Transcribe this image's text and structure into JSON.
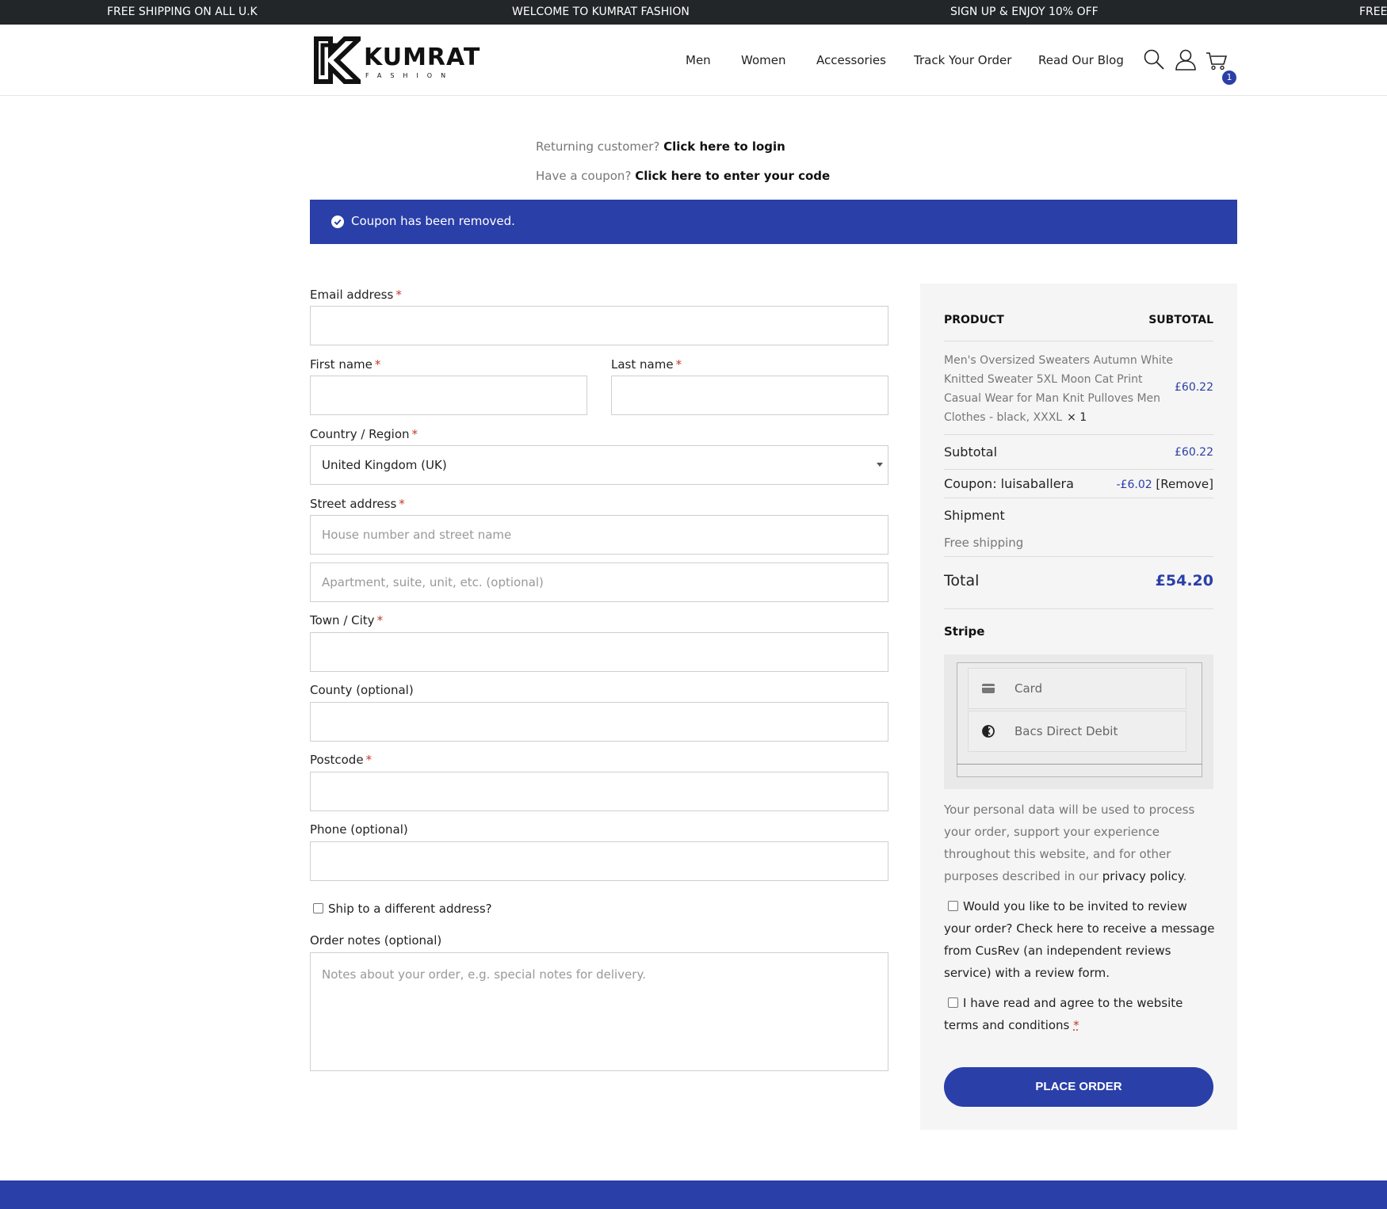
{
  "topbar": {
    "messages": [
      "FREE SHIPPING ON ALL U.K",
      "WELCOME TO KUMRAT FASHION",
      "SIGN UP & ENJOY 10% OFF",
      "FREE"
    ]
  },
  "header": {
    "logo_word": "KUMRAT",
    "logo_sub": "FASHION",
    "nav": [
      "Men",
      "Women",
      "Accessories",
      "Track Your Order",
      "Read Our Blog"
    ],
    "cart_count": "1",
    "icons": [
      "search-icon",
      "user-icon",
      "cart-icon"
    ]
  },
  "notices": {
    "returning_prefix": "Returning customer?",
    "returning_link": "Click here to login",
    "coupon_prefix": "Have a coupon?",
    "coupon_link": "Click here to enter your code",
    "alert": "Coupon has been removed."
  },
  "form": {
    "email_label": "Email address",
    "first_name_label": "First name",
    "last_name_label": "Last name",
    "country_label": "Country / Region",
    "country_value": "United Kingdom (UK)",
    "street_label": "Street address",
    "street_placeholder": "House number and street name",
    "apartment_placeholder": "Apartment, suite, unit, etc. (optional)",
    "city_label": "Town / City",
    "county_label": "County (optional)",
    "postcode_label": "Postcode",
    "phone_label": "Phone (optional)",
    "ship_different": "Ship to a different address?",
    "notes_label": "Order notes (optional)",
    "notes_placeholder": "Notes about your order, e.g. special notes for delivery.",
    "required_mark": "*"
  },
  "review": {
    "col_product": "PRODUCT",
    "col_subtotal": "SUBTOTAL",
    "product_name": "Men's Oversized Sweaters Autumn White Knitted Sweater 5XL Moon Cat Print Casual Wear for Man Knit Pulloves Men Clothes - black, XXXL",
    "product_qty": "× 1",
    "product_price": "£60.22",
    "subtotal_label": "Subtotal",
    "subtotal_value": "£60.22",
    "coupon_label": "Coupon: luisaballera",
    "coupon_value": "-£6.02",
    "coupon_remove": "[Remove]",
    "shipment_label": "Shipment",
    "shipment_value": "Free shipping",
    "total_label": "Total",
    "total_value": "£54.20",
    "payment_title": "Stripe",
    "payment_options": [
      "Card",
      "Bacs Direct Debit"
    ],
    "privacy_text": "Your personal data will be used to process your order, support your experience throughout this website, and for other purposes described in our",
    "privacy_link": "privacy policy",
    "privacy_end": ".",
    "review_invite": "Would you like to be invited to review your order? Check here to receive a message from CusRev (an independent reviews service) with a review form.",
    "terms_text": "I have read and agree to the website terms and conditions",
    "terms_required": "*",
    "place_order": "PLACE ORDER"
  },
  "colors": {
    "accent": "#2a3fa8",
    "topbar": "#232629",
    "required": "#c0392b"
  }
}
